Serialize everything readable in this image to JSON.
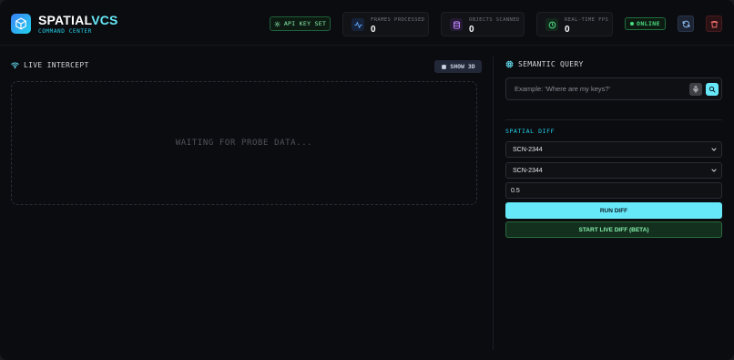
{
  "brand": {
    "name_main": "SPATIAL",
    "name_accent": "VCS",
    "subtitle": "COMMAND CENTER",
    "logo_icon": "cube-icon"
  },
  "header": {
    "api_key_label": "API KEY SET",
    "stats": [
      {
        "label": "FRAMES PROCESSED",
        "value": "0",
        "icon": "activity-icon",
        "color": "#60a5fa"
      },
      {
        "label": "OBJECTS SCANNED",
        "value": "0",
        "icon": "database-icon",
        "color": "#c084fc"
      },
      {
        "label": "REAL-TIME FPS",
        "value": "0",
        "icon": "clock-icon",
        "color": "#4ade80"
      }
    ],
    "status_label": "ONLINE",
    "refresh_icon": "refresh-icon",
    "delete_icon": "trash-icon"
  },
  "live": {
    "title": "LIVE INTERCEPT",
    "show_3d_label": "SHOW 3D",
    "waiting_text": "WAITING FOR PROBE DATA..."
  },
  "query": {
    "title": "SEMANTIC QUERY",
    "placeholder": "Example: 'Where are my keys?'"
  },
  "diff": {
    "title": "SPATIAL DIFF",
    "select_a": "SCN-2344",
    "select_b": "SCN-2344",
    "threshold": "0.5",
    "run_label": "RUN DIFF",
    "live_label": "START LIVE DIFF (BETA)"
  },
  "colors": {
    "accent": "#67e8f9",
    "success": "#4ade80",
    "danger": "#f87171",
    "background": "#0b0c10"
  }
}
